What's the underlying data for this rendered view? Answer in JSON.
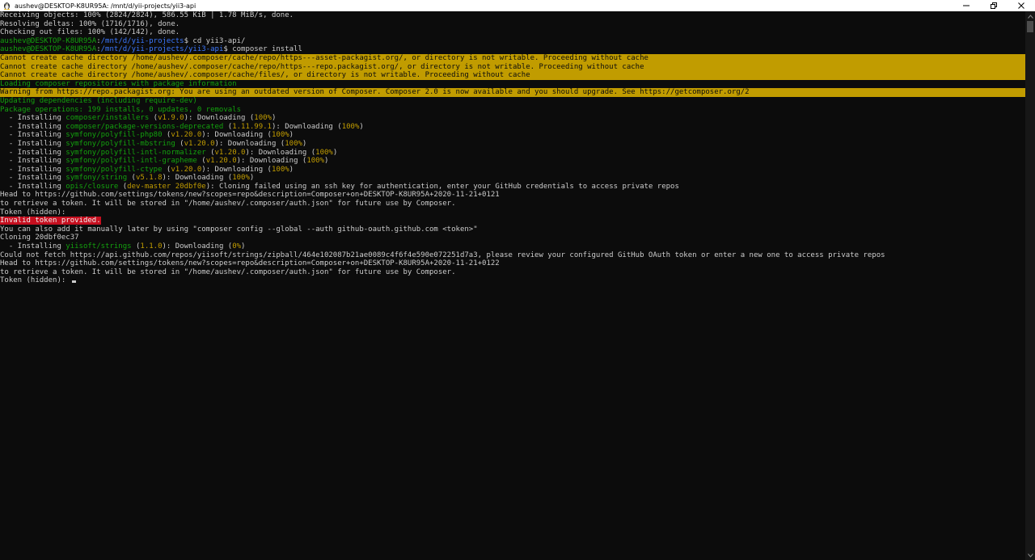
{
  "window": {
    "title": "aushev@DESKTOP-K8UR95A: /mnt/d/yii-projects/yii3-api"
  },
  "colors": {
    "background": "#0c0c0c",
    "default_text": "#cccccc",
    "green": "#13a10e",
    "blue": "#3b78ff",
    "yellow": "#c19c00",
    "red": "#c50f1f"
  },
  "terminal": {
    "lines": [
      [
        {
          "t": "Receiving objects: 100% (2824/2824), 586.55 KiB | 1.78 MiB/s, done."
        }
      ],
      [
        {
          "t": "Resolving deltas: 100% (1716/1716), done."
        }
      ],
      [
        {
          "t": "Checking out files: 100% (142/142), done."
        }
      ],
      [
        {
          "t": "aushev@DESKTOP-K8UR95A",
          "c": "green"
        },
        {
          "t": ":"
        },
        {
          "t": "/mnt/d/yii-projects",
          "c": "blue"
        },
        {
          "t": "$ cd yii3-api/"
        }
      ],
      [
        {
          "t": "aushev@DESKTOP-K8UR95A",
          "c": "green"
        },
        {
          "t": ":"
        },
        {
          "t": "/mnt/d/yii-projects/yii3-api",
          "c": "blue"
        },
        {
          "t": "$ composer install"
        }
      ],
      {
        "full": "yellow",
        "t": "Cannot create cache directory /home/aushev/.composer/cache/repo/https---asset-packagist.org/, or directory is not writable. Proceeding without cache"
      },
      {
        "full": "yellow",
        "t": "Cannot create cache directory /home/aushev/.composer/cache/repo/https---repo.packagist.org/, or directory is not writable. Proceeding without cache"
      },
      {
        "full": "yellow",
        "t": "Cannot create cache directory /home/aushev/.composer/cache/files/, or directory is not writable. Proceeding without cache"
      },
      [
        {
          "t": "Loading composer repositories with package information",
          "c": "green"
        }
      ],
      {
        "full": "yellow",
        "t": "Warning from https://repo.packagist.org: You are using an outdated version of Composer. Composer 2.0 is now available and you should upgrade. See https://getcomposer.org/2"
      },
      [
        {
          "t": "Updating dependencies (including require-dev)",
          "c": "green"
        }
      ],
      [
        {
          "t": "Package operations: 199 installs, 0 updates, 0 removals",
          "c": "green"
        }
      ],
      [
        {
          "t": "  - Installing "
        },
        {
          "t": "composer/installers",
          "c": "green"
        },
        {
          "t": " ("
        },
        {
          "t": "v1.9.0",
          "c": "yellow"
        },
        {
          "t": "): Downloading ("
        },
        {
          "t": "100%",
          "c": "yellow"
        },
        {
          "t": ")"
        }
      ],
      [
        {
          "t": "  - Installing "
        },
        {
          "t": "composer/package-versions-deprecated",
          "c": "green"
        },
        {
          "t": " ("
        },
        {
          "t": "1.11.99.1",
          "c": "yellow"
        },
        {
          "t": "): Downloading ("
        },
        {
          "t": "100%",
          "c": "yellow"
        },
        {
          "t": ")"
        }
      ],
      [
        {
          "t": "  - Installing "
        },
        {
          "t": "symfony/polyfill-php80",
          "c": "green"
        },
        {
          "t": " ("
        },
        {
          "t": "v1.20.0",
          "c": "yellow"
        },
        {
          "t": "): Downloading ("
        },
        {
          "t": "100%",
          "c": "yellow"
        },
        {
          "t": ")"
        }
      ],
      [
        {
          "t": "  - Installing "
        },
        {
          "t": "symfony/polyfill-mbstring",
          "c": "green"
        },
        {
          "t": " ("
        },
        {
          "t": "v1.20.0",
          "c": "yellow"
        },
        {
          "t": "): Downloading ("
        },
        {
          "t": "100%",
          "c": "yellow"
        },
        {
          "t": ")"
        }
      ],
      [
        {
          "t": "  - Installing "
        },
        {
          "t": "symfony/polyfill-intl-normalizer",
          "c": "green"
        },
        {
          "t": " ("
        },
        {
          "t": "v1.20.0",
          "c": "yellow"
        },
        {
          "t": "): Downloading ("
        },
        {
          "t": "100%",
          "c": "yellow"
        },
        {
          "t": ")"
        }
      ],
      [
        {
          "t": "  - Installing "
        },
        {
          "t": "symfony/polyfill-intl-grapheme",
          "c": "green"
        },
        {
          "t": " ("
        },
        {
          "t": "v1.20.0",
          "c": "yellow"
        },
        {
          "t": "): Downloading ("
        },
        {
          "t": "100%",
          "c": "yellow"
        },
        {
          "t": ")"
        }
      ],
      [
        {
          "t": "  - Installing "
        },
        {
          "t": "symfony/polyfill-ctype",
          "c": "green"
        },
        {
          "t": " ("
        },
        {
          "t": "v1.20.0",
          "c": "yellow"
        },
        {
          "t": "): Downloading ("
        },
        {
          "t": "100%",
          "c": "yellow"
        },
        {
          "t": ")"
        }
      ],
      [
        {
          "t": "  - Installing "
        },
        {
          "t": "symfony/string",
          "c": "green"
        },
        {
          "t": " ("
        },
        {
          "t": "v5.1.8",
          "c": "yellow"
        },
        {
          "t": "): Downloading ("
        },
        {
          "t": "100%",
          "c": "yellow"
        },
        {
          "t": ")"
        }
      ],
      [
        {
          "t": "  - Installing "
        },
        {
          "t": "opis/closure",
          "c": "green"
        },
        {
          "t": " ("
        },
        {
          "t": "dev-master 20dbf0e",
          "c": "yellow"
        },
        {
          "t": "): Cloning failed using an ssh key for authentication, enter your GitHub credentials to access private repos"
        }
      ],
      [
        {
          "t": "Head to https://github.com/settings/tokens/new?scopes=repo&description=Composer+on+DESKTOP-K8UR95A+2020-11-21+0121"
        }
      ],
      [
        {
          "t": "to retrieve a token. It will be stored in \"/home/aushev/.composer/auth.json\" for future use by Composer."
        }
      ],
      [
        {
          "t": "Token (hidden):"
        }
      ],
      [
        {
          "t": "Invalid token provided.",
          "c": "redbg"
        }
      ],
      [
        {
          "t": "You can also add it manually later by using \"composer config --global --auth github-oauth.github.com <token>\""
        }
      ],
      [
        {
          "t": "Cloning 20dbf0ec37"
        }
      ],
      [
        {
          "t": "  - Installing "
        },
        {
          "t": "yiisoft/strings",
          "c": "green"
        },
        {
          "t": " ("
        },
        {
          "t": "1.1.0",
          "c": "yellow"
        },
        {
          "t": "): Downloading ("
        },
        {
          "t": "0%",
          "c": "yellow"
        },
        {
          "t": ")"
        }
      ],
      [
        {
          "t": "Could not fetch https://api.github.com/repos/yiisoft/strings/zipball/464e102087b21ae0089c4f6f4e590e072251d7a3, please review your configured GitHub OAuth token or enter a new one to access private repos"
        }
      ],
      [
        {
          "t": "Head to https://github.com/settings/tokens/new?scopes=repo&description=Composer+on+DESKTOP-K8UR95A+2020-11-21+0122"
        }
      ],
      [
        {
          "t": "to retrieve a token. It will be stored in \"/home/aushev/.composer/auth.json\" for future use by Composer."
        }
      ],
      [
        {
          "t": "Token (hidden): "
        },
        {
          "cursor": true
        }
      ]
    ]
  }
}
